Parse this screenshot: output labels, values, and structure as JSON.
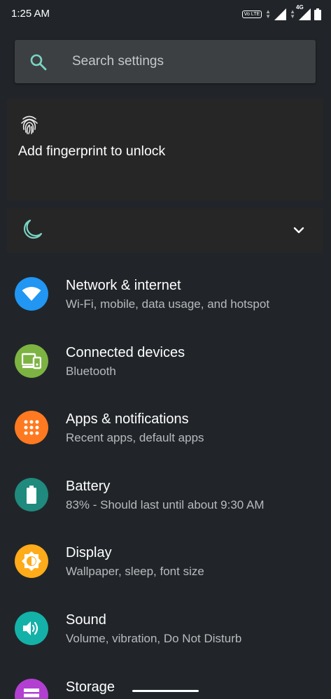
{
  "status_bar": {
    "time": "1:25 AM",
    "volte_label": "Vo LTE",
    "network_label": "4G"
  },
  "search": {
    "placeholder": "Search settings"
  },
  "fingerprint_card": {
    "label": "Add fingerprint to unlock"
  },
  "settings": {
    "items": [
      {
        "title": "Network & internet",
        "subtitle": "Wi-Fi, mobile, data usage, and hotspot",
        "icon": "wifi-icon",
        "color": "#2196f3"
      },
      {
        "title": "Connected devices",
        "subtitle": "Bluetooth",
        "icon": "devices-icon",
        "color": "#7cb342"
      },
      {
        "title": "Apps & notifications",
        "subtitle": "Recent apps, default apps",
        "icon": "apps-icon",
        "color": "#ff7920"
      },
      {
        "title": "Battery",
        "subtitle": "83% - Should last until about 9:30 AM",
        "icon": "battery-icon",
        "color": "#1f8a7d"
      },
      {
        "title": "Display",
        "subtitle": "Wallpaper, sleep, font size",
        "icon": "brightness-icon",
        "color": "#ffab1a"
      },
      {
        "title": "Sound",
        "subtitle": "Volume, vibration, Do Not Disturb",
        "icon": "volume-icon",
        "color": "#14b1a8"
      },
      {
        "title": "Storage",
        "subtitle": "",
        "icon": "storage-icon",
        "color": "#b23fd1"
      }
    ]
  },
  "colors": {
    "background": "#212529",
    "accent_teal": "#7bd4c4",
    "card": "#262626"
  }
}
